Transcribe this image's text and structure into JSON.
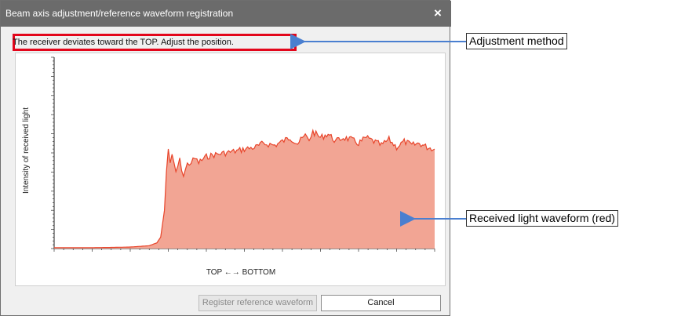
{
  "dialog": {
    "title": "Beam axis adjustment/reference waveform registration",
    "close_glyph": "×",
    "message": "The receiver deviates toward the TOP. Adjust the position.",
    "register_button": "Register reference waveform",
    "register_enabled": false,
    "cancel_button": "Cancel"
  },
  "annotations": [
    {
      "label": "Adjustment method"
    },
    {
      "label": "Received light waveform (red)"
    }
  ],
  "colors": {
    "titlebar": "#6b6b6b",
    "highlight_border": "#e3061b",
    "waveform_line": "#e8442a",
    "waveform_fill": "#f2a594",
    "arrow": "#4a7fd0"
  },
  "chart_data": {
    "type": "area",
    "ylabel": "Intensity of received light",
    "xlabel": "TOP ←→ BOTTOM",
    "grid": false,
    "x_range": [
      0,
      1
    ],
    "y_range": [
      0,
      1
    ],
    "series": [
      {
        "x": [
          0,
          0.05,
          0.1,
          0.15,
          0.2,
          0.25,
          0.27,
          0.28,
          0.29,
          0.295,
          0.3,
          0.305,
          0.31,
          0.32,
          0.33,
          0.34,
          0.35,
          0.36,
          0.37,
          0.38,
          0.4,
          0.42,
          0.45,
          0.48,
          0.5,
          0.53,
          0.55,
          0.58,
          0.6,
          0.62,
          0.64,
          0.66,
          0.67,
          0.68,
          0.7,
          0.72,
          0.74,
          0.76,
          0.78,
          0.8,
          0.82,
          0.84,
          0.86,
          0.88,
          0.9,
          0.92,
          0.94,
          0.96,
          0.98,
          1.0
        ],
        "y": [
          0.005,
          0.005,
          0.005,
          0.006,
          0.008,
          0.015,
          0.03,
          0.06,
          0.2,
          0.4,
          0.52,
          0.45,
          0.48,
          0.4,
          0.46,
          0.38,
          0.44,
          0.45,
          0.47,
          0.45,
          0.48,
          0.49,
          0.5,
          0.51,
          0.52,
          0.53,
          0.55,
          0.54,
          0.56,
          0.58,
          0.55,
          0.59,
          0.57,
          0.61,
          0.58,
          0.6,
          0.56,
          0.58,
          0.57,
          0.55,
          0.58,
          0.56,
          0.54,
          0.57,
          0.53,
          0.56,
          0.54,
          0.55,
          0.53,
          0.52
        ]
      }
    ]
  }
}
